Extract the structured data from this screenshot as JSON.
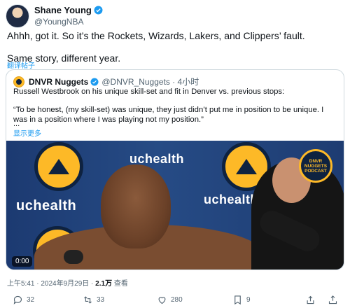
{
  "author": {
    "name": "Shane Young",
    "handle": "@YoungNBA"
  },
  "tweet": {
    "line1": "Ahhh, got it. So it’s the Rockets, Wizards, Lakers, and Clippers’ fault.",
    "line2": "Same story, different year.",
    "translate_label": "翻译帖子"
  },
  "quoted": {
    "name": "DNVR Nuggets",
    "handle_time": "@DNVR_Nuggets · 4小时",
    "line1": "Russell Westbrook on his unique skill-set and fit in Denver vs. previous stops:",
    "line2": "“To be honest, (my skill-set) was unique, they just didn’t put me in position to be unique. I was in a position where I was playing not my position.”",
    "ellipsis": "...",
    "show_more": "显示更多",
    "video": {
      "timer": "0:00",
      "sponsor_text": "uchealth",
      "badge_text": "DNVR NUGGETS PODCAST"
    }
  },
  "meta": {
    "time_date": "上午5:41 · 2024年9月29日 · ",
    "views_count": "2.1万",
    "views_label": " 查看"
  },
  "actions": {
    "replies": "32",
    "reposts": "33",
    "likes": "280",
    "bookmarks": "9"
  },
  "colors": {
    "accent": "#1d9bf0",
    "nuggets_gold": "#fdb927",
    "nuggets_navy": "#0e2240"
  }
}
